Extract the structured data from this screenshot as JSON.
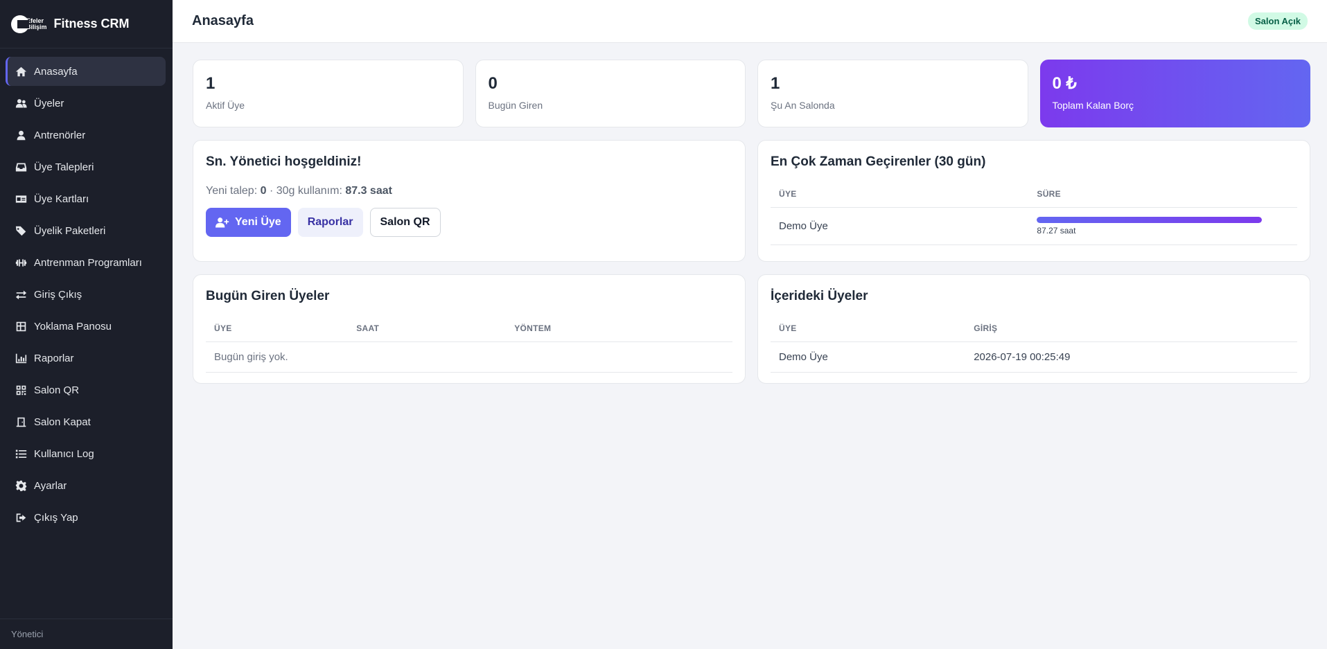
{
  "brand": {
    "logo_text_line1": "Efeler",
    "logo_text_line2": "Bilişim",
    "name": "Fitness CRM"
  },
  "sidebar": {
    "items": [
      {
        "label": "Anasayfa",
        "icon": "home-icon",
        "active": true
      },
      {
        "label": "Üyeler",
        "icon": "users-icon"
      },
      {
        "label": "Antrenörler",
        "icon": "user-icon"
      },
      {
        "label": "Üye Talepleri",
        "icon": "inbox-icon"
      },
      {
        "label": "Üye Kartları",
        "icon": "id-card-icon"
      },
      {
        "label": "Üyelik Paketleri",
        "icon": "tags-icon"
      },
      {
        "label": "Antrenman Programları",
        "icon": "dumbbell-icon"
      },
      {
        "label": "Giriş Çıkış",
        "icon": "exchange-icon"
      },
      {
        "label": "Yoklama Panosu",
        "icon": "grid-icon"
      },
      {
        "label": "Raporlar",
        "icon": "chart-icon"
      },
      {
        "label": "Salon QR",
        "icon": "qr-icon"
      },
      {
        "label": "Salon Kapat",
        "icon": "door-icon"
      },
      {
        "label": "Kullanıcı Log",
        "icon": "list-icon"
      },
      {
        "label": "Ayarlar",
        "icon": "gear-icon"
      },
      {
        "label": "Çıkış Yap",
        "icon": "sign-out-icon"
      }
    ],
    "footer": "Yönetici"
  },
  "header": {
    "title": "Anasayfa",
    "status": "Salon Açık"
  },
  "stats": [
    {
      "value": "1",
      "label": "Aktif Üye"
    },
    {
      "value": "0",
      "label": "Bugün Giren"
    },
    {
      "value": "1",
      "label": "Şu An Salonda"
    },
    {
      "value": "0 ₺",
      "label": "Toplam Kalan Borç"
    }
  ],
  "welcome": {
    "title": "Sn. Yönetici hoşgeldiniz!",
    "info_prefix": "Yeni talep: ",
    "new_requests": "0",
    "info_mid": " · 30g kullanım: ",
    "usage": "87.3 saat",
    "buttons": {
      "new_member": "Yeni Üye",
      "reports": "Raporlar",
      "salon_qr": "Salon QR"
    }
  },
  "top_time": {
    "title": "En Çok Zaman Geçirenler (30 gün)",
    "columns": [
      "ÜYE",
      "SÜRE"
    ],
    "rows": [
      {
        "member": "Demo Üye",
        "duration": "87.27 saat",
        "fill": 1.0
      }
    ]
  },
  "today_entries": {
    "title": "Bugün Giren Üyeler",
    "columns": [
      "ÜYE",
      "SAAT",
      "YÖNTEM"
    ],
    "empty": "Bugün giriş yok."
  },
  "inside": {
    "title": "İçerideki Üyeler",
    "columns": [
      "ÜYE",
      "GİRİŞ"
    ],
    "rows": [
      {
        "member": "Demo Üye",
        "entry": "2026-07-19 00:25:49"
      }
    ]
  },
  "colors": {
    "accent": "#6366f1",
    "sidebar": "#1c1f2a",
    "accent_gradient_end": "#7c3aed"
  }
}
